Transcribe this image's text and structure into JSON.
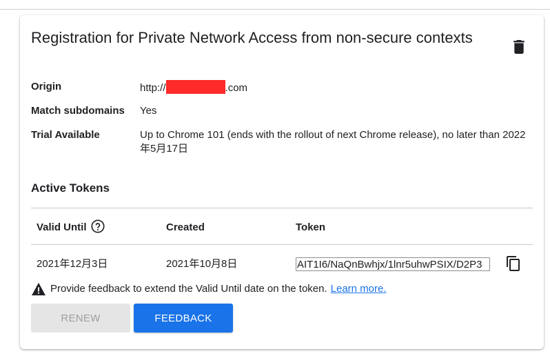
{
  "card": {
    "title": "Registration for Private Network Access from non-secure contexts",
    "delete_icon": "trash-icon"
  },
  "details": {
    "origin_label": "Origin",
    "origin_prefix": "http://",
    "origin_suffix": ".com",
    "match_label": "Match subdomains",
    "match_value": "Yes",
    "trial_label": "Trial Available",
    "trial_value": "Up to Chrome 101 (ends with the rollout of next Chrome release), no later than 2022年5月17日"
  },
  "tokens": {
    "section_title": "Active Tokens",
    "columns": {
      "valid_until": "Valid Until",
      "created": "Created",
      "token": "Token"
    },
    "help_icon": "help-circle-icon",
    "row": {
      "valid_until": "2021年12月3日",
      "created": "2021年10月8日",
      "token": "AIT1I6/NaQnBwhjx/1lnr5uhwPSIX/D2P3"
    },
    "copy_icon": "copy-icon"
  },
  "notice": {
    "text": "Provide feedback to extend the Valid Until date on the token.",
    "link": "Learn more.",
    "icon": "warning-icon"
  },
  "buttons": {
    "renew": "RENEW",
    "feedback": "FEEDBACK"
  },
  "colors": {
    "accent": "#1a73e8",
    "redaction": "#ff2a2a",
    "disabled_bg": "#e5e5e5",
    "disabled_text": "#9e9e9e"
  }
}
